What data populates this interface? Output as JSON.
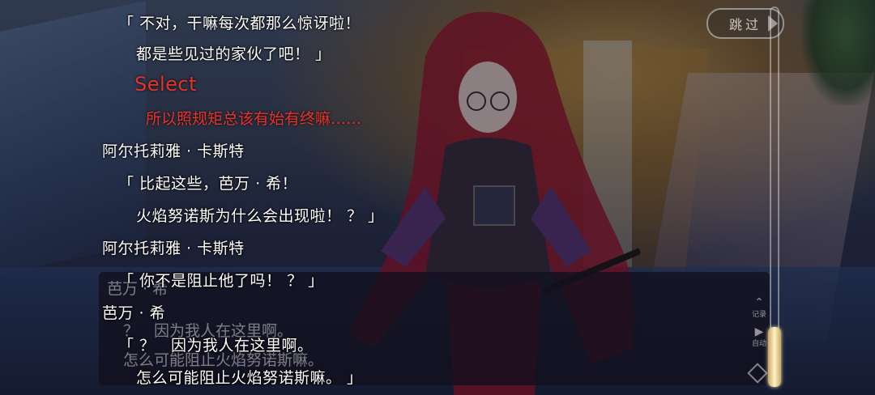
{
  "skip_label": "跳过",
  "backlog": {
    "line1": "「 不对，干嘛每次都那么惊讶啦！",
    "line2": "都是些见过的家伙了吧！ 」",
    "select_label": "Select",
    "choice_text": "所以照规矩总该有始有终嘛……",
    "speaker1": "阿尔托莉雅 · 卡斯特",
    "line3": "「 比起这些，芭万 · 希！",
    "line4": "火焰努诺斯为什么会出现啦！ ？ 」",
    "speaker2": "阿尔托莉雅 · 卡斯特",
    "line5": "「 你不是阻止他了吗！ ？ 」",
    "speaker3": "芭万 · 希",
    "line6": "「 ？　因为我人在这里啊。",
    "line7": "怎么可能阻止火焰努诺斯嘛。 」"
  },
  "dialogue": {
    "name": "芭万 · 希",
    "line1": "？　因为我人在这里啊。",
    "line2": "怎么可能阻止火焰努诺斯嘛。"
  },
  "controls": {
    "log_label": "记录",
    "auto_label": "自动"
  },
  "colors": {
    "choice_red": "#e8322c",
    "scroll_gold": "#c8a862"
  }
}
